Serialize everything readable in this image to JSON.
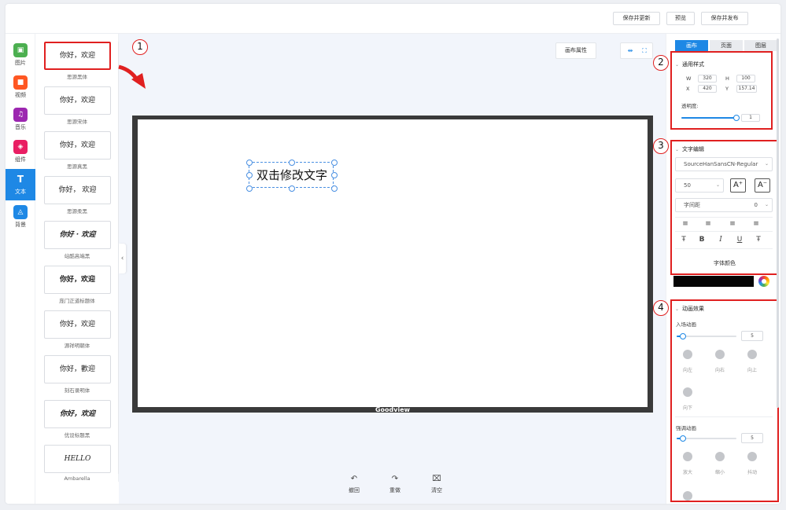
{
  "topbar": {
    "buttons": [
      {
        "label": "保存并更新"
      },
      {
        "label": "预览"
      },
      {
        "label": "保存并发布"
      }
    ]
  },
  "rail": {
    "items": [
      {
        "label": "图片",
        "icon": "image-icon",
        "color": "#4caf50"
      },
      {
        "label": "视频",
        "icon": "video-icon",
        "color": "#ff5722"
      },
      {
        "label": "音乐",
        "icon": "music-icon",
        "color": "#9c27b0"
      },
      {
        "label": "组件",
        "icon": "component-icon",
        "color": "#e91e63"
      },
      {
        "label": "文本",
        "icon": "text-icon",
        "color": "#1e88e5",
        "active": true
      },
      {
        "label": "背景",
        "icon": "background-icon",
        "color": "#1e88e5"
      }
    ]
  },
  "fonts": [
    {
      "sample": "你好，欢迎",
      "name": "思源黑体"
    },
    {
      "sample": "你好，欢迎",
      "name": "思源宋体"
    },
    {
      "sample": "你好，欢迎",
      "name": "思源真黑"
    },
    {
      "sample": "你好， 欢迎",
      "name": "思源柔黑"
    },
    {
      "sample": "你好 · 欢迎",
      "name": "站酷高端黑"
    },
    {
      "sample": "你好，欢迎",
      "name": "庞门正道标题体"
    },
    {
      "sample": "你好，欢迎",
      "name": "源祥明朝体"
    },
    {
      "sample": "你好，歡迎",
      "name": "刻石录明体"
    },
    {
      "sample": "你好，欢迎",
      "name": "优设标题黑"
    },
    {
      "sample": "HELLO",
      "name": "Ambarella"
    }
  ],
  "workspace": {
    "canvas_attr_label": "画布属性",
    "brand": "Goodview",
    "text_element": "双击修改文字",
    "tools": [
      {
        "label": "撤回",
        "icon": "undo-icon",
        "glyph": "↶"
      },
      {
        "label": "重做",
        "icon": "redo-icon",
        "glyph": "↷"
      },
      {
        "label": "清空",
        "icon": "clear-icon",
        "glyph": "⌧"
      }
    ]
  },
  "callouts": [
    "1",
    "2",
    "3",
    "4"
  ],
  "right": {
    "tabs": [
      "画布",
      "页面",
      "图层"
    ],
    "general": {
      "title": "通用样式",
      "w_label": "W",
      "w_value": "320",
      "h_label": "H",
      "h_value": "100",
      "x_label": "X",
      "x_value": "420",
      "y_label": "Y",
      "y_value": "157.14",
      "opacity_label": "透明度:",
      "opacity_value": "1",
      "opacity_level": 1
    },
    "text_edit": {
      "title": "文字编辑",
      "font": "SourceHanSansCN-Regular",
      "size": "50",
      "size_up": "A⁺",
      "size_down": "A⁻",
      "spacing_label": "字间距",
      "spacing_value": "0",
      "align_icons": [
        "align-left-icon",
        "align-center-icon",
        "align-right-icon",
        "align-justify-icon"
      ],
      "styles": [
        {
          "glyph": "Ŧ",
          "icon": "text-style-icon"
        },
        {
          "glyph": "B",
          "icon": "bold-icon"
        },
        {
          "glyph": "I",
          "icon": "italic-icon"
        },
        {
          "glyph": "U",
          "icon": "underline-icon"
        },
        {
          "glyph": "Ŧ",
          "icon": "strikethrough-icon"
        }
      ],
      "color_label": "字体颜色",
      "color": "#050505"
    },
    "animation": {
      "title": "动画效果",
      "enter_label": "入场动画",
      "enter_value": "5",
      "enter_level": 0.1,
      "enter_items": [
        "向左",
        "向右",
        "向上",
        "向下"
      ],
      "emphasis_label": "强调动画",
      "emphasis_value": "5",
      "emphasis_level": 0.1,
      "emphasis_items": [
        "放大",
        "缩小",
        "抖动"
      ]
    }
  }
}
